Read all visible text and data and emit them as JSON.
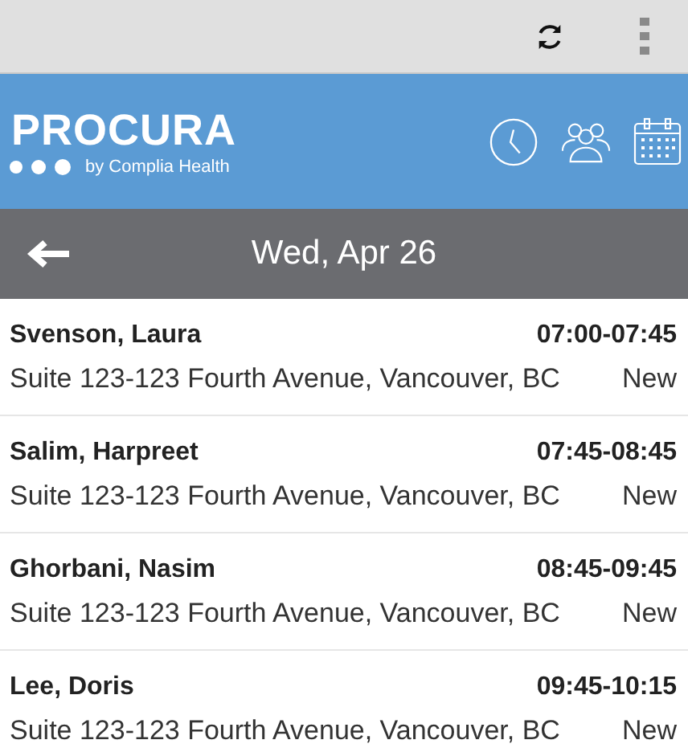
{
  "header": {
    "logo": "PROCURA",
    "tagline": "by Complia Health"
  },
  "date_bar": {
    "title": "Wed, Apr 26"
  },
  "appointments": [
    {
      "name": "Svenson, Laura",
      "time": "07:00-07:45",
      "address": "Suite 123-123 Fourth Avenue, Vancouver, BC",
      "status": "New"
    },
    {
      "name": "Salim, Harpreet",
      "time": "07:45-08:45",
      "address": "Suite 123-123 Fourth Avenue, Vancouver, BC",
      "status": "New"
    },
    {
      "name": "Ghorbani, Nasim",
      "time": "08:45-09:45",
      "address": "Suite 123-123 Fourth Avenue, Vancouver, BC",
      "status": "New"
    },
    {
      "name": "Lee, Doris",
      "time": "09:45-10:15",
      "address": "Suite 123-123 Fourth Avenue, Vancouver, BC",
      "status": "New"
    }
  ]
}
